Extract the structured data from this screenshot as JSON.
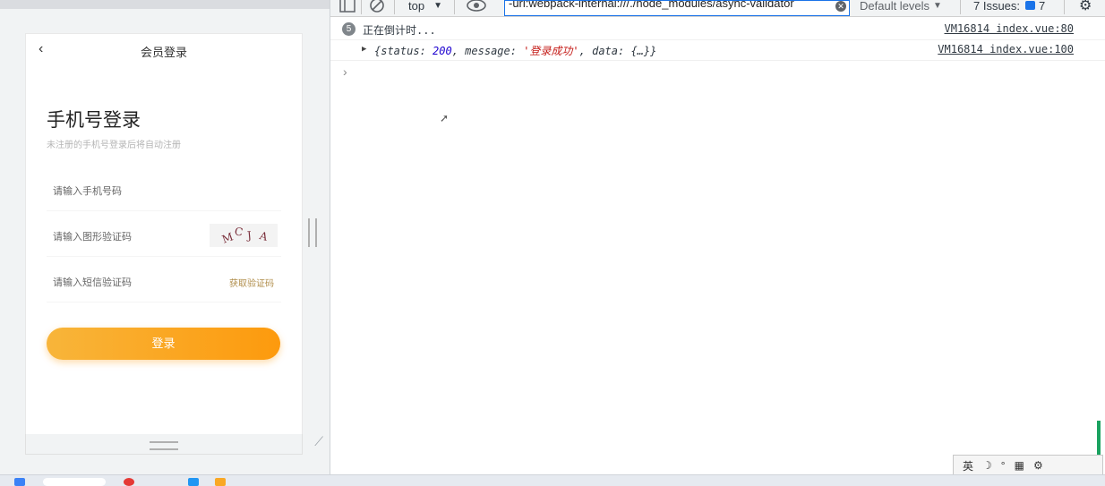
{
  "phone_ui": {
    "nav_title": "会员登录",
    "back_icon": "‹",
    "page_title": "手机号登录",
    "subtitle": "未注册的手机号登录后将自动注册",
    "phone_placeholder": "请输入手机号码",
    "captcha_placeholder": "请输入图形验证码",
    "captcha_text": [
      "M",
      "C",
      "J",
      "A"
    ],
    "sms_placeholder": "请输入短信验证码",
    "sms_link": "获取验证码",
    "login_button": "登录"
  },
  "devtools": {
    "toolbar": {
      "context": "top",
      "filter_value": "-url:webpack-internal:///./node_modules/async-validator",
      "levels": "Default levels",
      "issues_label": "7 Issues:",
      "issues_count": "7"
    },
    "console": [
      {
        "count": "5",
        "message": "正在倒计时...",
        "source": "VM16814 index.vue:80"
      },
      {
        "source": "VM16814 index.vue:100",
        "object": {
          "open": "{",
          "status_key": "status: ",
          "status_val": "200",
          "message_key": ", message: ",
          "message_val": "'登录成功'",
          "data_key": ", data: ",
          "data_val": "{…}",
          "close": "}"
        }
      }
    ],
    "prompt": "›"
  },
  "ime": {
    "lang": "英",
    "moon": "☽",
    "dot": "°",
    "grid": "▦",
    "gear": "⚙"
  }
}
